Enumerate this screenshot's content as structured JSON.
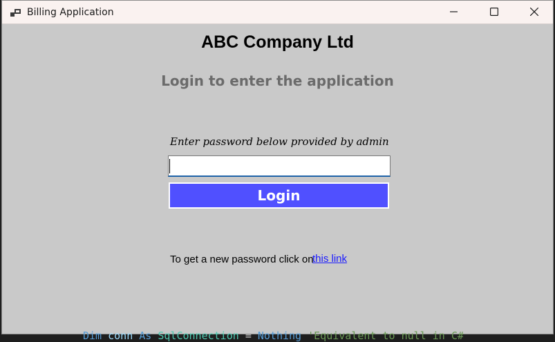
{
  "window": {
    "title": "Billing Application"
  },
  "header": {
    "company_name": "ABC Company Ltd",
    "subtitle": "Login to enter the application"
  },
  "form": {
    "password_label": "Enter password below provided by admin",
    "password_value": "",
    "login_label": "Login"
  },
  "footer": {
    "help_text": "To get a new password click on",
    "link_text": "this link"
  },
  "background_code": {
    "text": "Dim conn As SqlConnection = Nothing  'Equivalent to null in C#"
  },
  "colors": {
    "window_bg": "#c9c9c9",
    "titlebar_bg": "#faf2f0",
    "login_button": "#5050ff",
    "link": "#1a1aff"
  }
}
